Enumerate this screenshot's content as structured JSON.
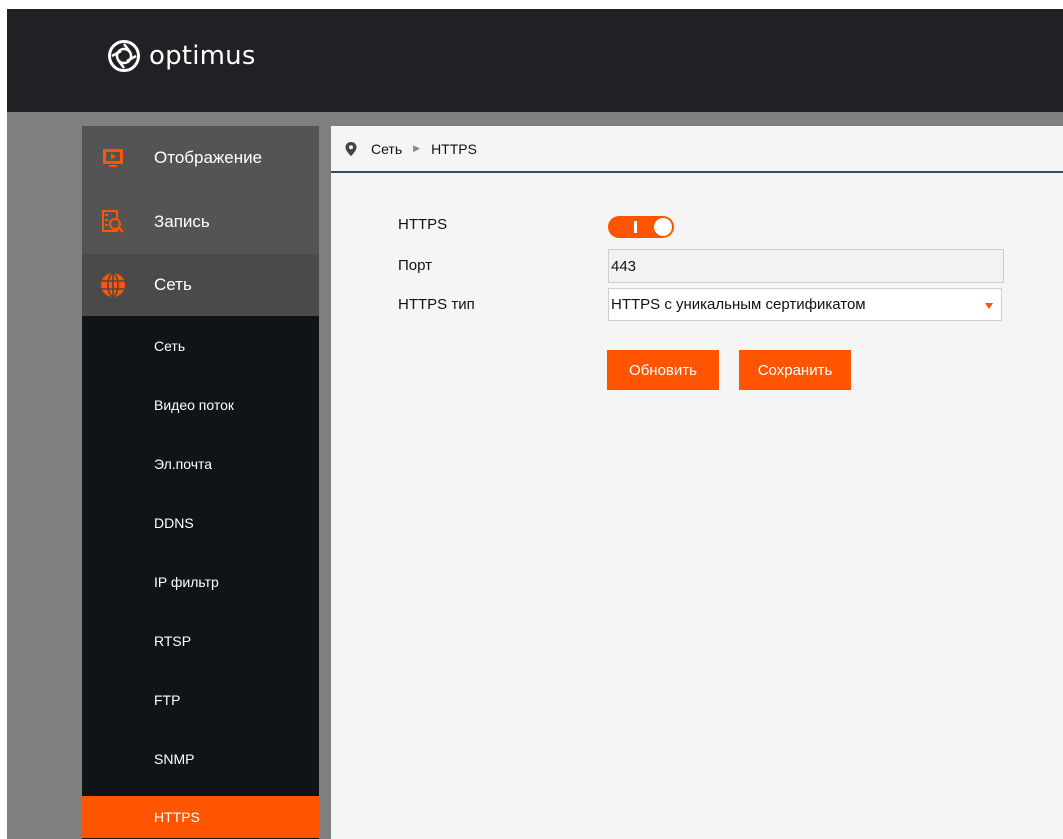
{
  "brand": {
    "name": "optimus",
    "accent": "#ff5500"
  },
  "nav": {
    "main": [
      {
        "label": "Отображение",
        "icon": "monitor-play-icon"
      },
      {
        "label": "Запись",
        "icon": "record-search-icon"
      },
      {
        "label": "Сеть",
        "icon": "globe-icon"
      }
    ],
    "sub": [
      {
        "label": "Сеть"
      },
      {
        "label": "Видео поток"
      },
      {
        "label": "Эл.почта"
      },
      {
        "label": "DDNS"
      },
      {
        "label": "IP фильтр"
      },
      {
        "label": "RTSP"
      },
      {
        "label": "FTP"
      },
      {
        "label": "SNMP"
      },
      {
        "label": "HTTPS"
      }
    ],
    "active_sub": "HTTPS"
  },
  "breadcrumb": {
    "parent": "Сеть",
    "current": "HTTPS"
  },
  "form": {
    "https_label": "HTTPS",
    "https_enabled": true,
    "port_label": "Порт",
    "port_value": "443",
    "type_label": "HTTPS тип",
    "type_value": "HTTPS с уникальным сертификатом"
  },
  "buttons": {
    "refresh": "Обновить",
    "save": "Сохранить"
  }
}
